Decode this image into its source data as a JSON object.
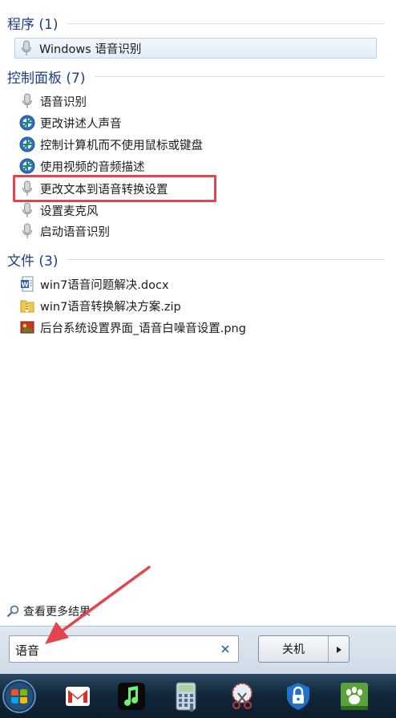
{
  "sections": {
    "programs": {
      "title": "程序 (1)",
      "items": [
        {
          "label": "Windows 语音识别",
          "icon": "microphone-icon"
        }
      ]
    },
    "control_panel": {
      "title": "控制面板 (7)",
      "items": [
        {
          "label": "语音识别",
          "icon": "microphone-icon"
        },
        {
          "label": "更改讲述人声音",
          "icon": "ease-of-access-icon"
        },
        {
          "label": "控制计算机而不使用鼠标或键盘",
          "icon": "ease-of-access-icon"
        },
        {
          "label": "使用视频的音频描述",
          "icon": "ease-of-access-icon"
        },
        {
          "label": "更改文本到语音转换设置",
          "icon": "microphone-icon"
        },
        {
          "label": "设置麦克风",
          "icon": "microphone-icon"
        },
        {
          "label": "启动语音识别",
          "icon": "microphone-icon"
        }
      ]
    },
    "files": {
      "title": "文件 (3)",
      "items": [
        {
          "label": "win7语音问题解决.docx",
          "icon": "word-document-icon"
        },
        {
          "label": "win7语音转换解决方案.zip",
          "icon": "zip-folder-icon"
        },
        {
          "label": "后台系统设置界面_语音白噪音设置.png",
          "icon": "image-file-icon"
        }
      ]
    }
  },
  "see_more": {
    "label": "查看更多结果",
    "icon": "magnifier-icon"
  },
  "search": {
    "value": "语音",
    "clear_icon": "close-icon"
  },
  "shutdown": {
    "label": "关机",
    "arrow_icon": "triangle-right-icon"
  },
  "taskbar": {
    "icons": [
      "start-orb-icon",
      "gmail-icon",
      "music-app-icon",
      "calculator-icon",
      "snipping-tool-icon",
      "password-lock-icon",
      "paw-app-icon"
    ]
  },
  "annotations": {
    "highlight_color": "#e2454f",
    "arrow_color": "#e2454f"
  },
  "colors": {
    "section_title": "#1e3d87",
    "selection_border": "#b9d0ec"
  }
}
